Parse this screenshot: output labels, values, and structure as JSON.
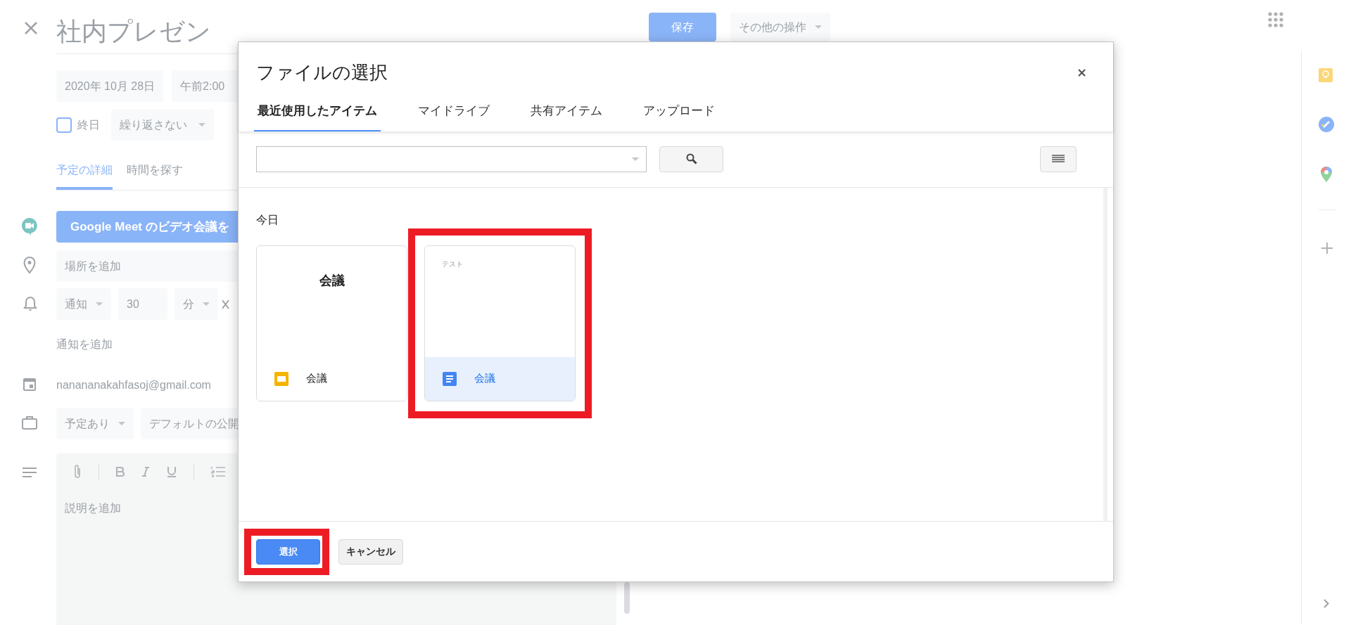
{
  "event": {
    "title": "社内プレゼン",
    "save": "保存",
    "more_actions": "その他の操作",
    "date": "2020年 10月 28日",
    "time": "午前2:00",
    "all_day": {
      "label": "終日",
      "checked": false
    },
    "repeat": "繰り返さない",
    "tabs": [
      {
        "label": "予定の詳細",
        "selected": true
      },
      {
        "label": "時間を探す",
        "selected": false
      }
    ],
    "meet_button": "Google Meet のビデオ会議を",
    "location": {
      "placeholder": "場所を追加"
    },
    "notification": {
      "type": "通知",
      "value": "30",
      "unit": "分"
    },
    "add_notification": "通知を追加",
    "calendar": "nanananakahfasoj@gmail.com",
    "availability": "予定あり",
    "visibility": "デフォルトの公開",
    "description": {
      "placeholder": "説明を追加"
    }
  },
  "dialog": {
    "title": "ファイルの選択",
    "tabs": [
      {
        "label": "最近使用したアイテム",
        "selected": true
      },
      {
        "label": "マイドライブ",
        "selected": false
      },
      {
        "label": "共有アイテム",
        "selected": false
      },
      {
        "label": "アップロード",
        "selected": false
      }
    ],
    "section": "今日",
    "files": [
      {
        "kind": "slides",
        "preview": "会議",
        "name": "会議",
        "selected": false
      },
      {
        "kind": "docs",
        "preview": "テスト",
        "name": "会議",
        "selected": true
      }
    ],
    "buttons": [
      {
        "label": "選択",
        "kind": "primary"
      },
      {
        "label": "キャンセル",
        "kind": "secondary"
      }
    ]
  }
}
